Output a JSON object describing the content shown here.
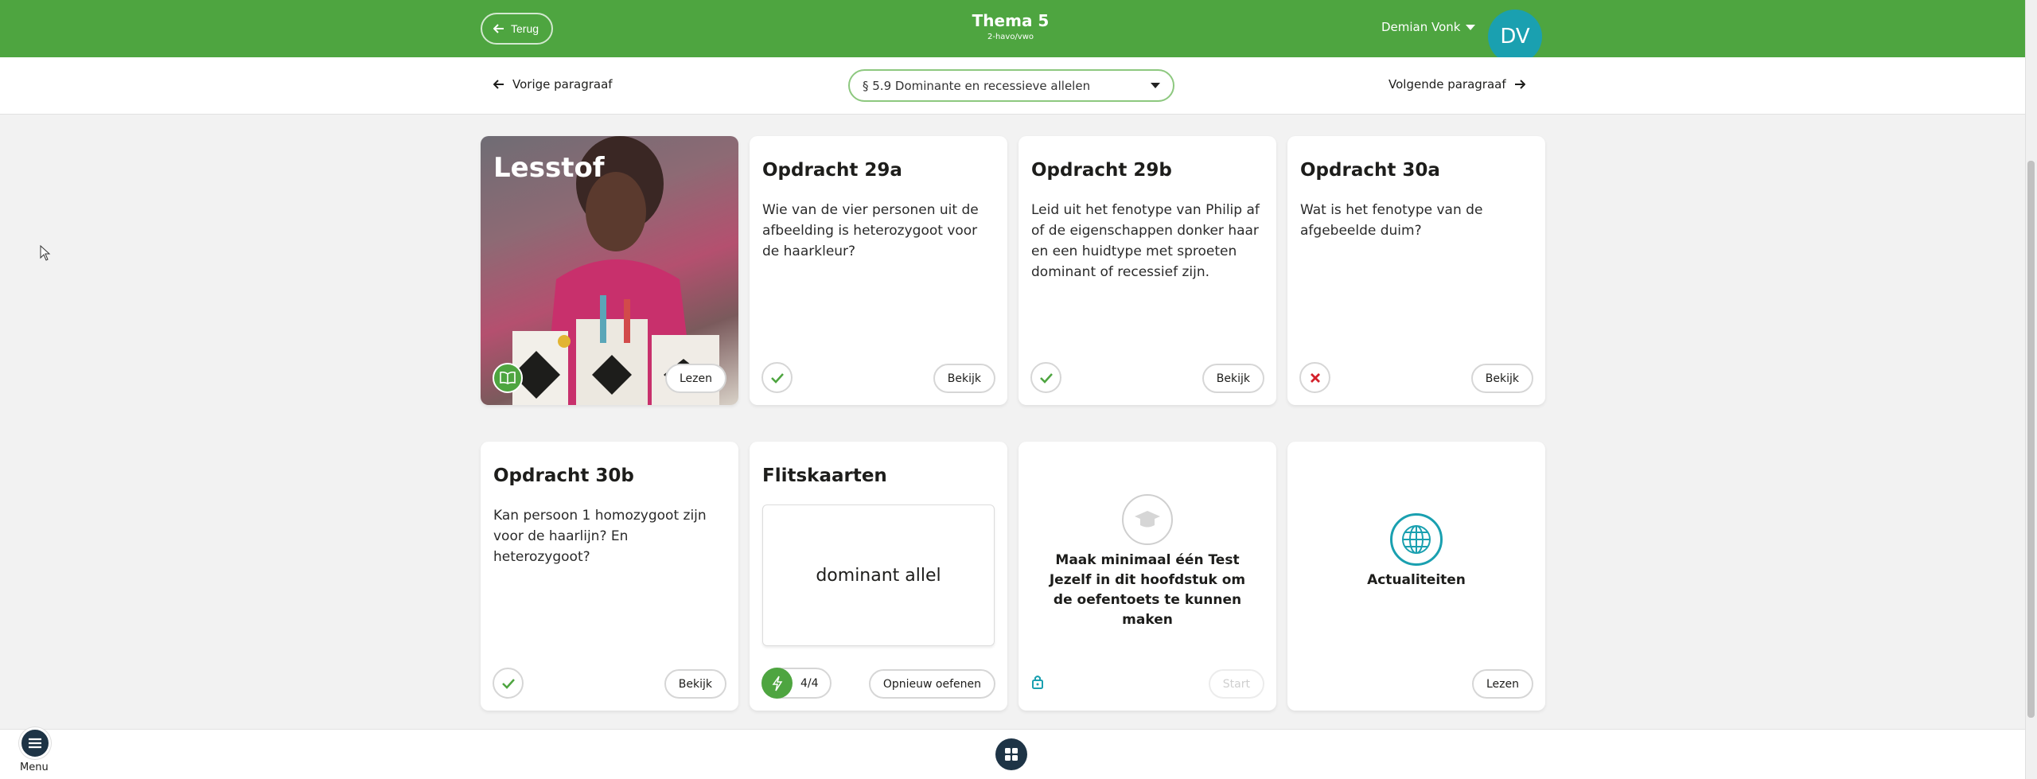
{
  "header": {
    "back_label": "Terug",
    "title": "Thema 5",
    "subtitle": "2-havo/vwo",
    "user_name": "Demian Vonk",
    "avatar_initials": "DV",
    "brand_color": "#4ea540",
    "avatar_color": "#1aa0b0"
  },
  "subnav": {
    "prev_label": "Vorige paragraaf",
    "next_label": "Volgende paragraaf",
    "selected_section": "§ 5.9 Dominante en recessieve allelen"
  },
  "cards": {
    "lesstof": {
      "title": "Lesstof",
      "action": "Lezen",
      "icon": "book-icon"
    },
    "opd29a": {
      "title": "Opdracht 29a",
      "text": "Wie van de vier personen uit de afbeelding is heterozygoot voor de haarkleur?",
      "status": "correct",
      "action": "Bekijk"
    },
    "opd29b": {
      "title": "Opdracht 29b",
      "text": "Leid uit het fenotype van Philip af of de eigenschappen donker haar en een huidtype met sproeten dominant of recessief zijn.",
      "status": "correct",
      "action": "Bekijk"
    },
    "opd30a": {
      "title": "Opdracht 30a",
      "text": "Wat is het fenotype van de afgebeelde duim?",
      "status": "incorrect",
      "action": "Bekijk"
    },
    "opd30b": {
      "title": "Opdracht 30b",
      "text": "Kan persoon 1 homozygoot zijn voor de haarlijn? En heterozygoot?",
      "status": "correct",
      "action": "Bekijk"
    },
    "flits": {
      "title": "Flitskaarten",
      "card_text": "dominant allel",
      "progress": "4/4",
      "action": "Opnieuw oefenen"
    },
    "toets": {
      "message": "Maak minimaal één Test Jezelf in dit hoofdstuk om de oefentoets te kunnen maken",
      "action": "Start",
      "icon": "graduation-cap-icon",
      "locked": true
    },
    "actu": {
      "label": "Actualiteiten",
      "action": "Lezen",
      "icon": "globe-icon"
    }
  },
  "footer": {
    "menu_label": "Menu"
  }
}
